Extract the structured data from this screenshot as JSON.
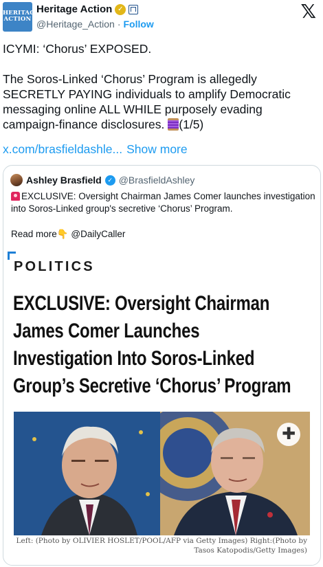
{
  "author": {
    "name": "Heritage Action",
    "handle": "@Heritage_Action",
    "avatar_text": "HERITAGE ACTION",
    "follow_label": "Follow"
  },
  "tweet": {
    "line1": "ICYMI: ‘Chorus’ EXPOSED.",
    "body": "The Soros-Linked ‘Chorus’ Program is allegedly SECRETLY PAYING individuals to amplify Democratic messaging online ALL WHILE purposely evading campaign-finance disclosures.",
    "counter": "(1/5)",
    "link": "x.com/brasfieldashle...",
    "show_more": "Show more"
  },
  "quote": {
    "name": "Ashley Brasfield",
    "handle": "@BrasfieldAshley",
    "text": "EXCLUSIVE: Oversight Chairman James Comer launches investigation into Soros-Linked group's secretive ‘Chorus’ Program.",
    "read_more": "Read more",
    "read_more_source": "@DailyCaller"
  },
  "article": {
    "section": "POLITICS",
    "headline_lines": [
      "EXCLUSIVE: Oversight Chairman",
      "James Comer Launches",
      "Investigation Into Soros-Linked",
      "Group’s Secretive ‘Chorus’ Program"
    ],
    "caption_line1": "Left: (Photo by OLIVIER HOSLET/POOL/AFP via Getty Images) Right:(Photo by",
    "caption_line2": "Tasos Katopodis/Getty Images)"
  },
  "colors": {
    "link": "#1d9bf0",
    "gold_check": "#e2b719",
    "blue_check": "#1d9bf0",
    "avatar_bg": "#3d84c6"
  }
}
